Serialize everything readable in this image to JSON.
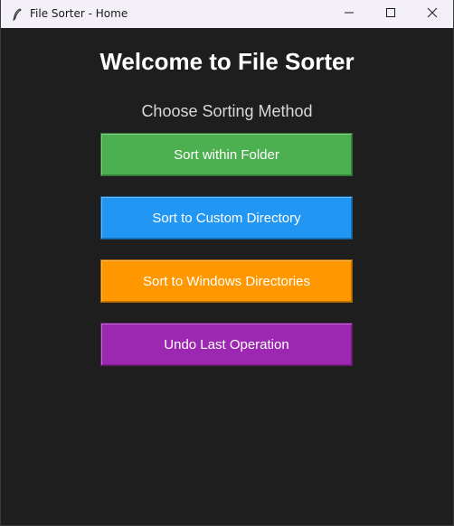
{
  "window": {
    "title": "File Sorter - Home",
    "app_icon": "feather-icon",
    "controls": {
      "minimize_icon": "minimize-icon",
      "maximize_icon": "maximize-icon",
      "close_icon": "close-icon"
    }
  },
  "main": {
    "heading": "Welcome to File Sorter",
    "subheading": "Choose Sorting Method",
    "buttons": [
      {
        "label": "Sort within Folder",
        "color": "#4caf50"
      },
      {
        "label": "Sort to Custom Directory",
        "color": "#2196f3"
      },
      {
        "label": "Sort to Windows Directories",
        "color": "#ff9800"
      },
      {
        "label": "Undo Last Operation",
        "color": "#9c27b0"
      }
    ]
  },
  "colors": {
    "background": "#1e1e1e",
    "titlebar": "#f3f0f8"
  }
}
